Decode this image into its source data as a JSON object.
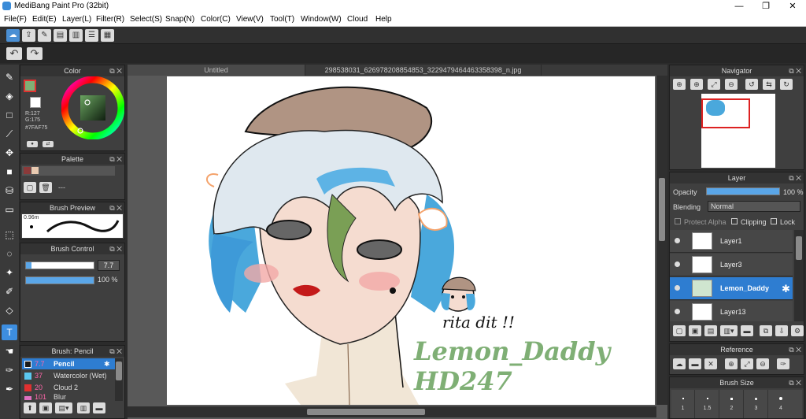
{
  "window": {
    "title": "MediBang Paint Pro (32bit)",
    "minimize": "—",
    "maximize": "❐",
    "close": "✕"
  },
  "menu": [
    "File(F)",
    "Edit(E)",
    "Layer(L)",
    "Filter(R)",
    "Select(S)",
    "Snap(N)",
    "Color(C)",
    "View(V)",
    "Tool(T)",
    "Window(W)",
    "Cloud",
    "Help"
  ],
  "toolbar1": {
    "icons": [
      "cloud-icon",
      "share-icon",
      "comment-icon",
      "message-icon",
      "page-icon",
      "list-icon",
      "grid-icon"
    ]
  },
  "toolbar2": {
    "undo": "↶",
    "redo": "↷"
  },
  "tabs": [
    {
      "label": "Untitled"
    },
    {
      "label": "298538031_626978208854853_3229479464463358398_n.jpg"
    }
  ],
  "color_panel": {
    "title": "Color",
    "r": "R:127",
    "g": "G:175",
    "hex": "#7FAF75",
    "fg_color": "#7FAF75",
    "bg_color": "#ffffff"
  },
  "palette_panel": {
    "title": "Palette",
    "label": "---",
    "colors": [
      "#8b3a3a",
      "#e8c9b0"
    ]
  },
  "brush_preview": {
    "title": "Brush Preview",
    "size": "0.96m"
  },
  "brush_control": {
    "title": "Brush Control",
    "size_value": "7.7",
    "opacity_value": "100 %",
    "size_level": 0.08,
    "opacity_level": 1.0
  },
  "brush_list": {
    "title": "Brush: Pencil",
    "items": [
      {
        "size": "7.7",
        "name": "Pencil",
        "color": "#1a1a1a",
        "selected": true
      },
      {
        "size": "37",
        "name": "Watercolor (Wet)",
        "color": "#5bc8f0",
        "selected": false
      },
      {
        "size": "20",
        "name": "Cloud 2",
        "color": "#e03030",
        "selected": false
      },
      {
        "size": "101",
        "name": "Blur",
        "color": "#e070c0",
        "selected": false
      }
    ]
  },
  "navigator": {
    "title": "Navigator"
  },
  "layer_panel": {
    "title": "Layer",
    "opacity_label": "Opacity",
    "opacity_value": "100 %",
    "opacity_level": 1.0,
    "blending_label": "Blending",
    "blending_value": "Normal",
    "protect_alpha": "Protect Alpha",
    "clipping": "Clipping",
    "lock": "Lock",
    "layers": [
      {
        "name": "Layer1",
        "selected": false
      },
      {
        "name": "Layer3",
        "selected": false
      },
      {
        "name": "Lemon_Daddy",
        "selected": true
      },
      {
        "name": "Layer13",
        "selected": false
      }
    ]
  },
  "reference_panel": {
    "title": "Reference"
  },
  "brush_size_panel": {
    "title": "Brush Size",
    "sizes": [
      "1",
      "1.5",
      "2",
      "3",
      "4"
    ]
  },
  "artwork": {
    "signature": "rita dit !!",
    "watermark_line1": "Lemon_Daddy",
    "watermark_line2": "HD247",
    "watermark_color": "#7FAF75"
  }
}
